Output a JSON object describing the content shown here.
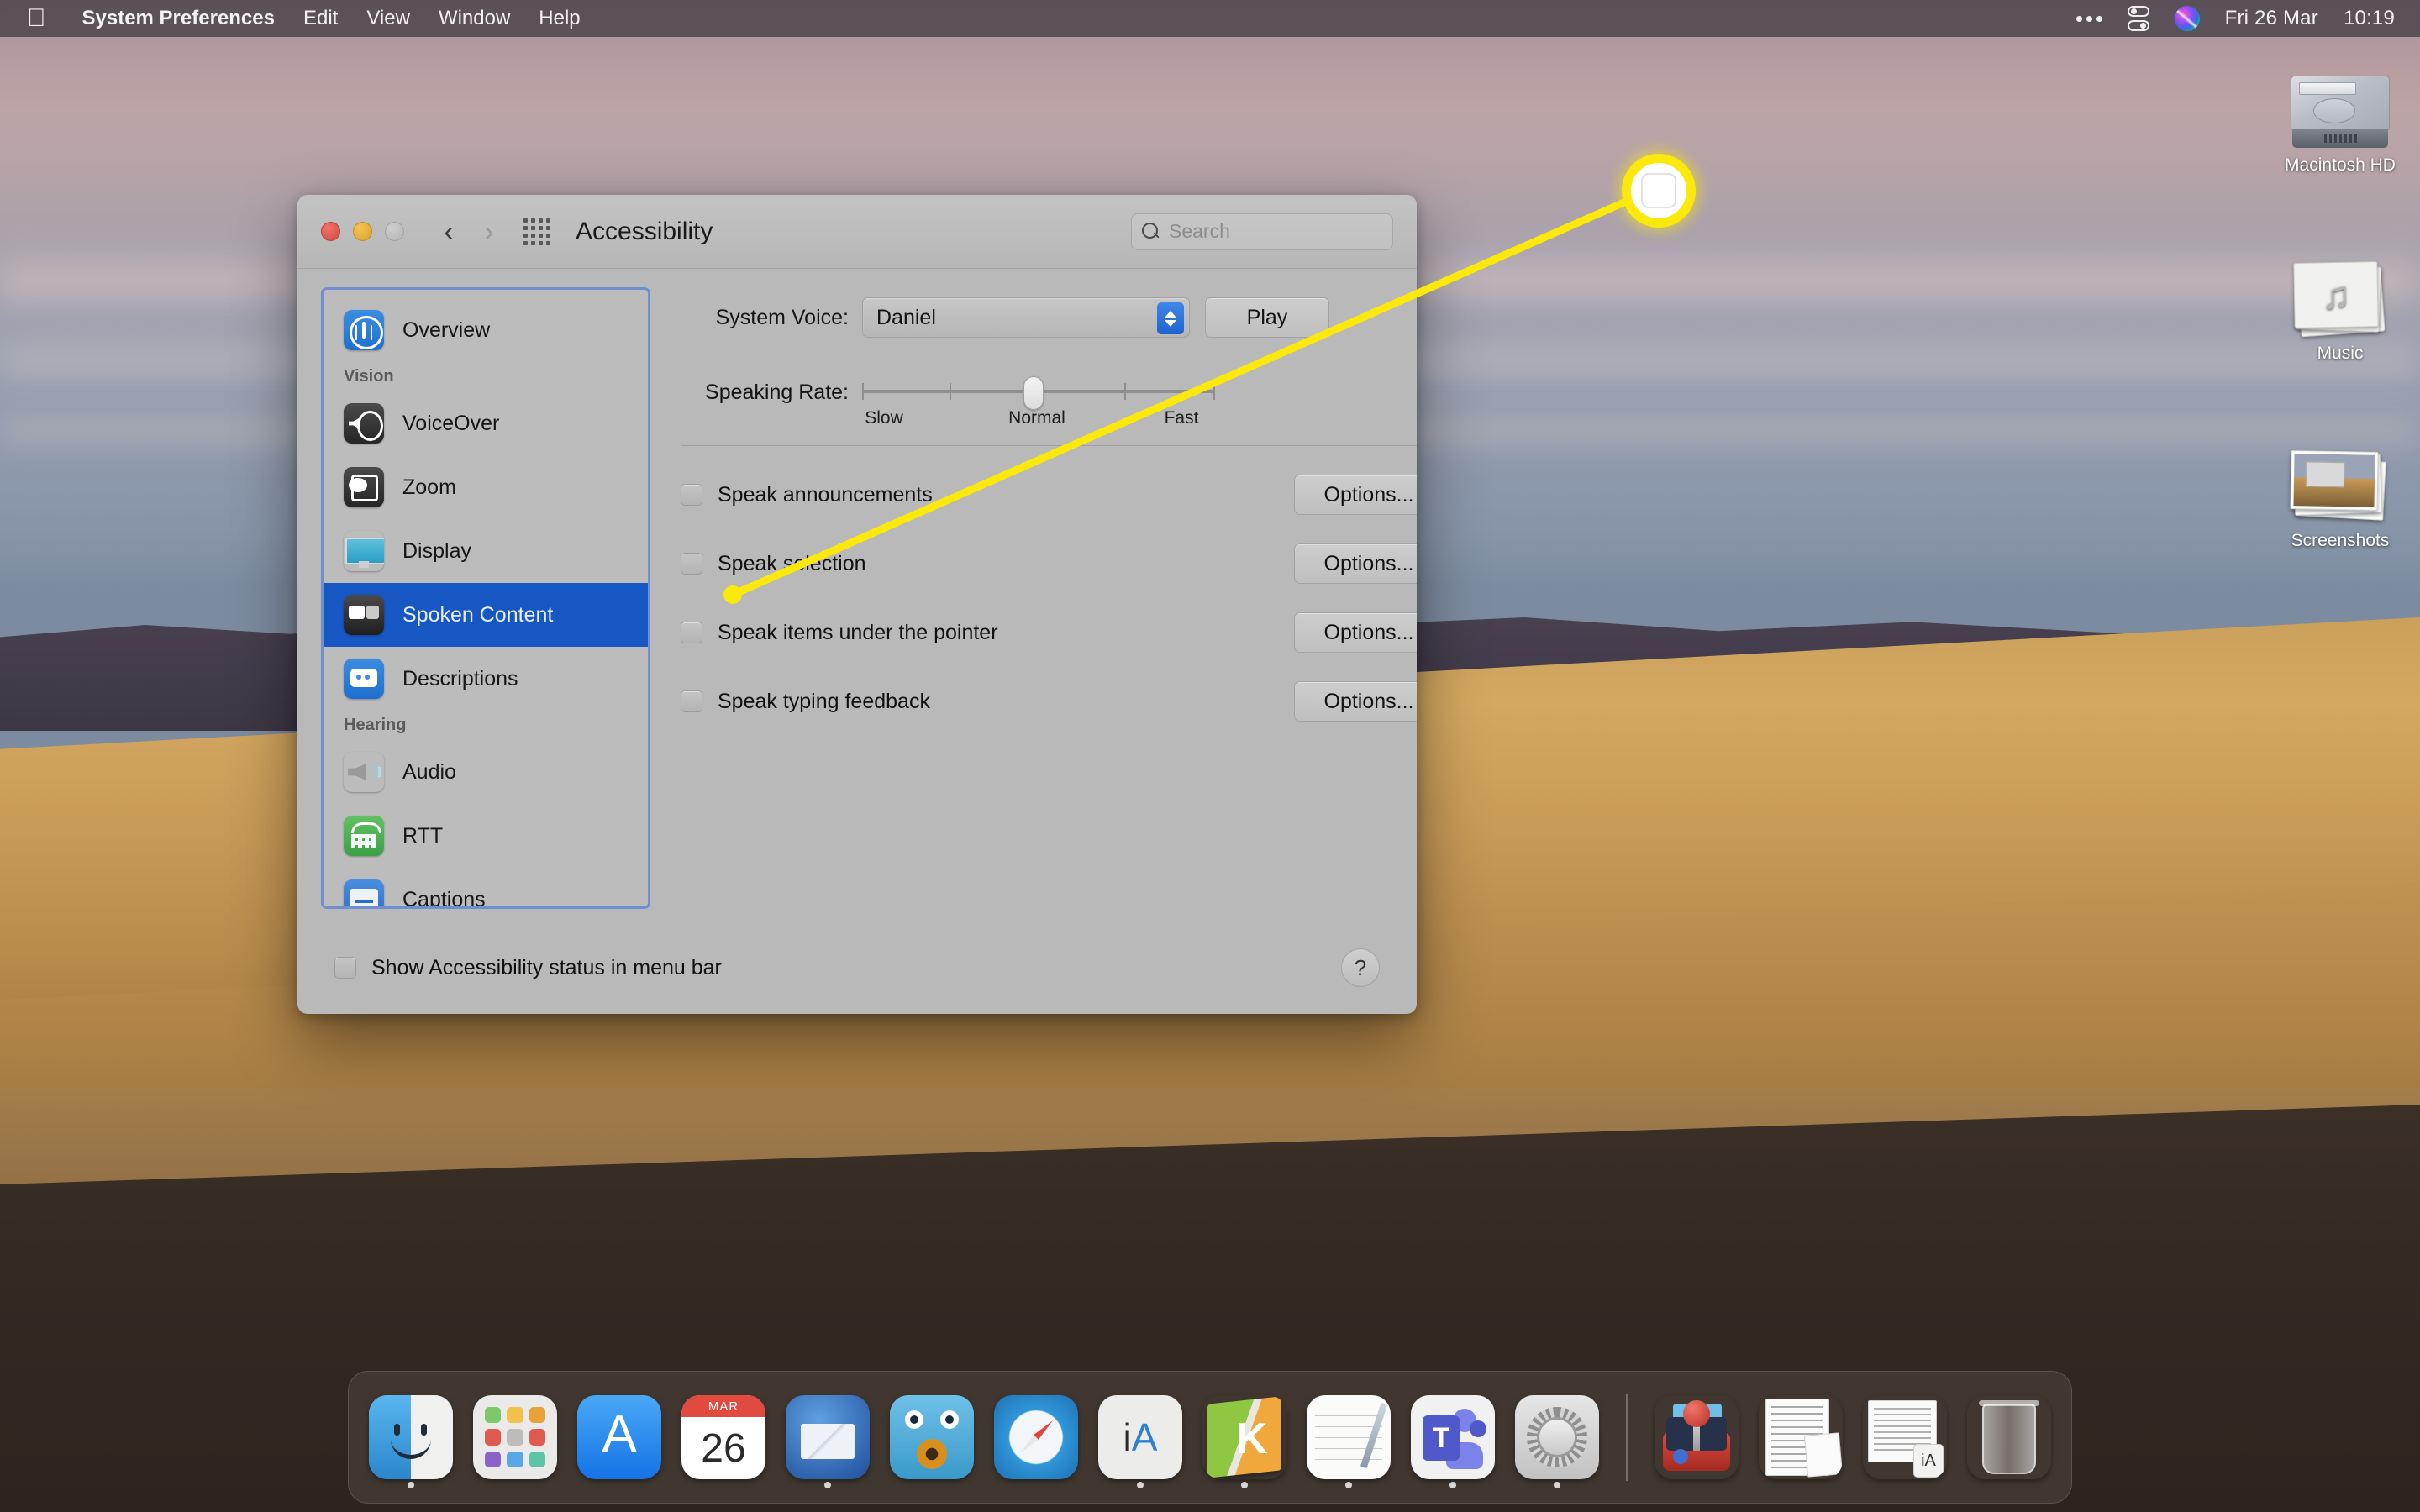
{
  "menubar": {
    "apple_icon": "apple-logo-icon",
    "items": [
      {
        "label": "System Preferences",
        "bold": true
      },
      {
        "label": "Edit",
        "bold": false
      },
      {
        "label": "View",
        "bold": false
      },
      {
        "label": "Window",
        "bold": false
      },
      {
        "label": "Help",
        "bold": false
      }
    ],
    "status_icons": [
      "ellipsis-icon",
      "control-center-icon",
      "siri-icon"
    ],
    "date": "Fri 26 Mar",
    "time": "10:19"
  },
  "desktop": {
    "icons": [
      {
        "label": "Macintosh HD",
        "icon": "hard-drive-icon"
      },
      {
        "label": "Music",
        "icon": "music-folder-icon"
      },
      {
        "label": "Screenshots",
        "icon": "screenshots-stack-icon"
      }
    ]
  },
  "window": {
    "title": "Accessibility",
    "traffic_lights": [
      "close-button",
      "minimize-button",
      "zoom-button"
    ],
    "nav": {
      "back": "back-chevron-icon",
      "forward": "forward-chevron-icon"
    },
    "show_all_icon": "grid-icon",
    "search": {
      "placeholder": "Search",
      "value": "",
      "icon": "search-icon"
    }
  },
  "sidebar": {
    "items": [
      {
        "label": "Overview",
        "icon": "accessibility-icon",
        "kind": "item",
        "selected": false
      },
      {
        "label": "Vision",
        "kind": "header"
      },
      {
        "label": "VoiceOver",
        "icon": "voiceover-icon",
        "kind": "item",
        "selected": false
      },
      {
        "label": "Zoom",
        "icon": "zoom-magnifier-icon",
        "kind": "item",
        "selected": false
      },
      {
        "label": "Display",
        "icon": "display-monitor-icon",
        "kind": "item",
        "selected": false
      },
      {
        "label": "Spoken Content",
        "icon": "spoken-content-icon",
        "kind": "item",
        "selected": true
      },
      {
        "label": "Descriptions",
        "icon": "descriptions-icon",
        "kind": "item",
        "selected": false
      },
      {
        "label": "Hearing",
        "kind": "header"
      },
      {
        "label": "Audio",
        "icon": "audio-speaker-icon",
        "kind": "item",
        "selected": false
      },
      {
        "label": "RTT",
        "icon": "rtt-phone-icon",
        "kind": "item",
        "selected": false
      },
      {
        "label": "Captions",
        "icon": "captions-icon",
        "kind": "item",
        "selected": false
      }
    ]
  },
  "content": {
    "system_voice": {
      "label": "System Voice:",
      "value": "Daniel",
      "play_label": "Play"
    },
    "speaking_rate": {
      "label": "Speaking Rate:",
      "ticks": [
        "Slow",
        "Normal",
        "Fast"
      ],
      "thumb_position_label": "Normal"
    },
    "checkboxes": [
      {
        "label": "Speak announcements",
        "checked": false,
        "button": "Options..."
      },
      {
        "label": "Speak selection",
        "checked": false,
        "button": "Options..."
      },
      {
        "label": "Speak items under the pointer",
        "checked": false,
        "button": "Options..."
      },
      {
        "label": "Speak typing feedback",
        "checked": false,
        "button": "Options..."
      }
    ]
  },
  "footer": {
    "menubar_checkbox": {
      "label": "Show Accessibility status in menu bar",
      "checked": false
    },
    "help_label": "?"
  },
  "annotation": {
    "type": "callout-circle",
    "target": "speak-announcements-checkbox",
    "color": "#fbe90b"
  },
  "dock": {
    "items": [
      {
        "name": "finder",
        "running": true
      },
      {
        "name": "launchpad",
        "running": false
      },
      {
        "name": "app-store",
        "running": false
      },
      {
        "name": "calendar",
        "running": false,
        "month": "MAR",
        "day": "26"
      },
      {
        "name": "thunderbird",
        "running": true
      },
      {
        "name": "tweetbot",
        "running": false
      },
      {
        "name": "safari",
        "running": false
      },
      {
        "name": "ia-writer",
        "running": true
      },
      {
        "name": "kindle",
        "running": true
      },
      {
        "name": "textedit",
        "running": true
      },
      {
        "name": "microsoft-teams",
        "running": true
      },
      {
        "name": "system-preferences",
        "running": true
      }
    ],
    "stack_items": [
      {
        "name": "game-joystick"
      },
      {
        "name": "documents-stack"
      },
      {
        "name": "ia-writer-document"
      },
      {
        "name": "trash"
      }
    ]
  }
}
